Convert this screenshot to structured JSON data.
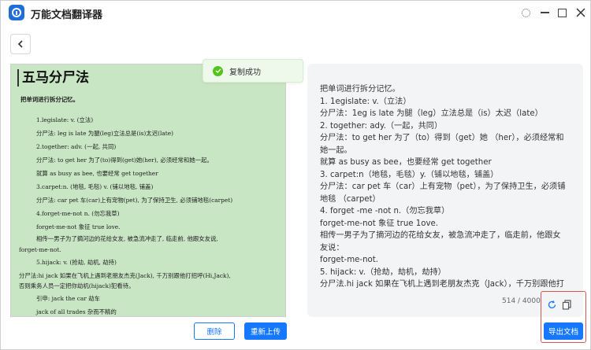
{
  "app": {
    "title": "万能文档翻译器"
  },
  "toast": {
    "message": "复制成功"
  },
  "document": {
    "title": "五马分尸法",
    "lines": [
      "把单词进行拆分记忆。",
      "1.legislate: v. (立法)",
      "分尸法: leg is late 为腿(leg)立法总是(is)太迟(late)",
      "2.together: adv. (一起, 共同)",
      "分尸法: to get her 为了(to)得到(get)她(her), 必须经常和她一起。",
      "就算 as busy as bee, 也要经常 get together",
      "3.carpet:n. (地毯, 毛毯) v. (铺以地毯, 铺盖)",
      "分尸法: car pet 车(car)上有宠物(pet), 为了保持卫生, 必须铺地毯(carpet)",
      "4.forget-me-not n. (勿忘我草)",
      "forget-me-not 象征 true love.",
      "相传一男子为了摘河边的花给女友, 被急流冲走了, 临走前, 他跟女友说,",
      "forget-me-not.",
      "5.hijack: v. (抢劫, 劫机, 劫持)",
      "分尸法:hi jack 如果在飞机上遇到老朋友杰克(Jack), 千万别跟他打招呼(Hi,Jack),",
      "否则乘务人员一定把你劫机(hijack)犯看待。",
      "引申: jack the car 劫车",
      "jack of all trades 杂而不精的"
    ]
  },
  "translation": {
    "lines": [
      "把单词进行拆分记忆。",
      "1. 1egislate: v.（立法）",
      "分尸法：1eg is late 为腿（leg）立法总是（is）太迟（late）",
      "2. together: ady.（一起，共同）",
      "分尸法：to get her 为了（to）得到（get）她 （her），必须经常和",
      "她一起。",
      "就算 as busy as bee，也要经常 get together",
      "3. carpet:n（地毯，毛毯）y.（铺以地毯，铺盖）",
      "分尸法：car pet 车（car）上有宠物（pet），为了保持卫生，必须铺",
      "地毯 （carpet）",
      "4. forget -me -not n.（勿忘我草）",
      "forget-me-not 象征 true 1ove.",
      "相传一男子为了摘河边的花给女友，被急流冲走了，临走前，他跟女",
      "友说：",
      "forget-me-not.",
      "5. hijack: v.（抢劫，劫机，劫持）",
      "分尸法.hi jack 如果在飞机上遇到老朋友杰克（Jack），千万别跟他打"
    ],
    "char_count": "514 / 4000"
  },
  "buttons": {
    "delete": "删除",
    "reupload": "重新上传",
    "export": "导出文档"
  },
  "colors": {
    "primary": "#1677ff",
    "doc_background": "#c8e6c4",
    "toast_success": "#52c41a",
    "highlight_box": "#d9534f"
  }
}
